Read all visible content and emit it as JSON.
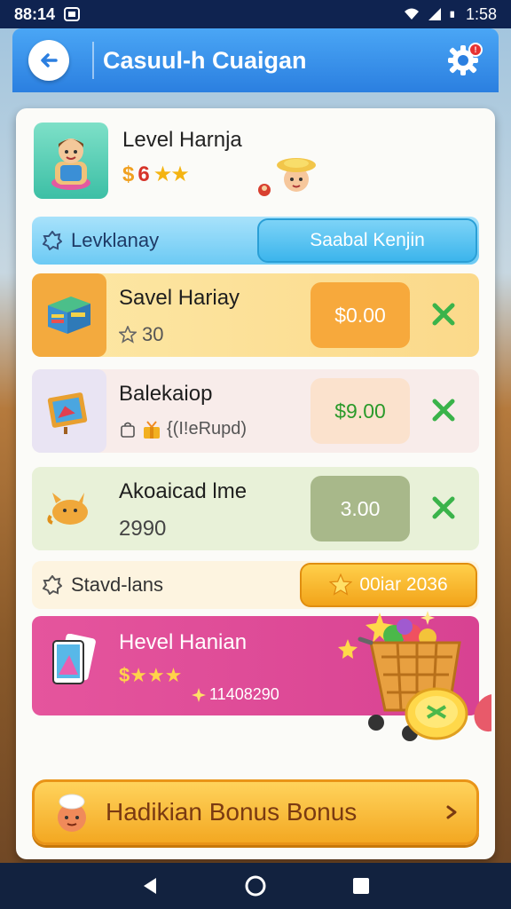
{
  "status_bar": {
    "left_text": "88:14",
    "time": "1:58"
  },
  "header": {
    "title": "Casuul-h Cuaigan",
    "notification_count": "!"
  },
  "profile": {
    "name": "Level Harnja",
    "currency": "$",
    "amount": "6",
    "stars": "★★"
  },
  "section_top": {
    "label": "Levklanay",
    "button": "Saabal Kenjin"
  },
  "items": [
    {
      "title": "Savel Hariay",
      "sub_value": "30",
      "price": "$0.00"
    },
    {
      "title": "Balekaiop",
      "sub_value": "{(I!eRupd)",
      "price": "$9.00"
    },
    {
      "title": "Akoaicad lme",
      "sub_value": "2990",
      "price": "3.00"
    }
  ],
  "section_mid": {
    "label": "Stavd-lans",
    "button": "00iar 2036"
  },
  "promo": {
    "title": "Hevel Hanian",
    "stars": "$★★★",
    "count": "11408290"
  },
  "bonus_button": {
    "label": "Hadikian Bonus Bonus"
  },
  "colors": {
    "header_blue": "#2b7fe0",
    "accent_gold": "#f3a822",
    "promo_pink": "#e5559d",
    "check_green": "#3ab34a"
  }
}
